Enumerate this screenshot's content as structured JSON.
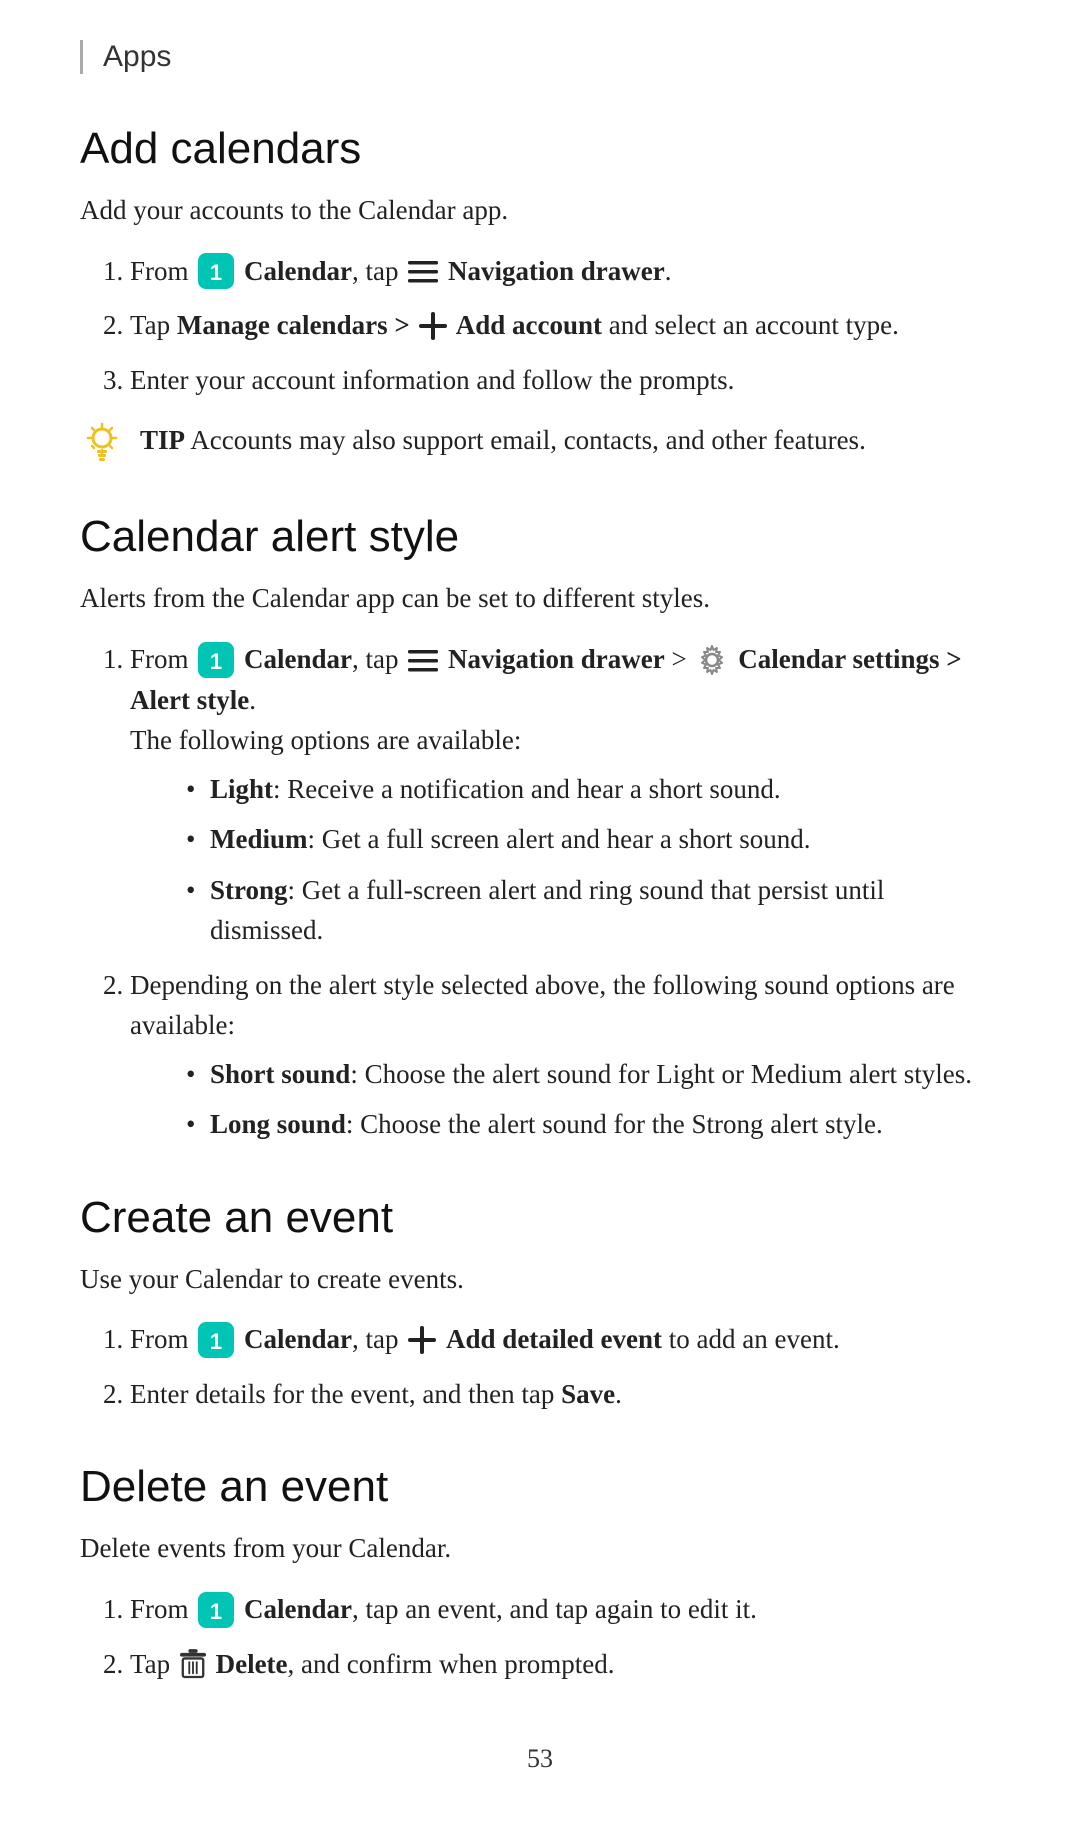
{
  "header": {
    "title": "Apps",
    "border_color": "#aaaaaa"
  },
  "sections": [
    {
      "id": "add-calendars",
      "title": "Add calendars",
      "intro": "Add your accounts to the Calendar app.",
      "steps": [
        {
          "text_parts": [
            {
              "type": "text",
              "content": "From "
            },
            {
              "type": "calendar-icon"
            },
            {
              "type": "bold",
              "content": " Calendar"
            },
            {
              "type": "text",
              "content": ", tap "
            },
            {
              "type": "nav-icon"
            },
            {
              "type": "bold",
              "content": " Navigation drawer"
            },
            {
              "type": "text",
              "content": "."
            }
          ],
          "plain": "From  Calendar, tap  Navigation drawer."
        },
        {
          "plain": "Tap Manage calendars >  Add account and select an account type."
        },
        {
          "plain": "Enter your account information and follow the prompts."
        }
      ],
      "tip": "Accounts may also support email, contacts, and other features."
    },
    {
      "id": "calendar-alert-style",
      "title": "Calendar alert style",
      "intro": "Alerts from the Calendar app can be set to different styles.",
      "steps": [
        {
          "plain": "From  Calendar, tap  Navigation drawer >  Calendar settings > Alert style.",
          "sub": "The following options are available:",
          "bullets": [
            {
              "bold": "Light",
              "text": ": Receive a notification and hear a short sound."
            },
            {
              "bold": "Medium",
              "text": ": Get a full screen alert and hear a short sound."
            },
            {
              "bold": "Strong",
              "text": ": Get a full-screen alert and ring sound that persist until dismissed."
            }
          ]
        },
        {
          "plain": "Depending on the alert style selected above, the following sound options are available:",
          "bullets": [
            {
              "bold": "Short sound",
              "text": ": Choose the alert sound for Light or Medium alert styles."
            },
            {
              "bold": "Long sound",
              "text": ": Choose the alert sound for the Strong alert style."
            }
          ]
        }
      ]
    },
    {
      "id": "create-an-event",
      "title": "Create an event",
      "intro": "Use your Calendar to create events.",
      "steps": [
        {
          "plain": "From  Calendar, tap  Add detailed event to add an event."
        },
        {
          "plain": "Enter details for the event, and then tap Save."
        }
      ]
    },
    {
      "id": "delete-an-event",
      "title": "Delete an event",
      "intro": "Delete events from your Calendar.",
      "steps": [
        {
          "plain": "From  Calendar, tap an event, and tap again to edit it."
        },
        {
          "plain": "Tap  Delete, and confirm when prompted."
        }
      ]
    }
  ],
  "page_number": "53",
  "colors": {
    "calendar_bg": "#00c4b4",
    "tip_yellow": "#f0c020",
    "accent_cyan": "#00bcd4"
  }
}
